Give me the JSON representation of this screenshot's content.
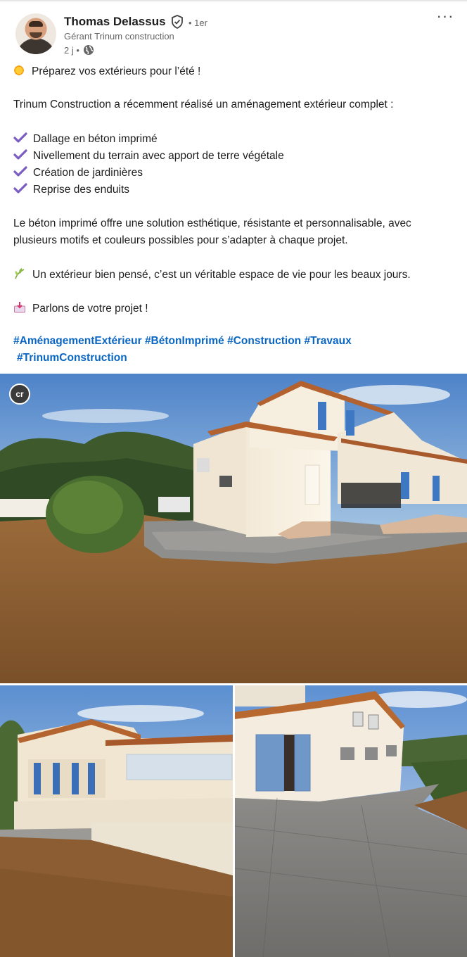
{
  "author": {
    "name": "Thomas Delassus",
    "degree": "• 1er",
    "headline": "Gérant Trinum construction",
    "time": "2 j •",
    "more_label": "···"
  },
  "post": {
    "line1": "Préparez vos extérieurs pour l’été !",
    "intro": "Trinum Construction a récemment réalisé un aménagement extérieur complet :",
    "checklist": [
      "Dallage en béton imprimé",
      "Nivellement du terrain avec apport de terre végétale",
      "Création de jardinières",
      "Reprise des enduits"
    ],
    "para1": "Le béton imprimé offre une solution esthétique, résistante et personnalisable, avec",
    "para2": "plusieurs motifs et couleurs possibles pour s’adapter à chaque projet.",
    "leaf_line": "Un extérieur bien pensé, c’est un véritable espace de vie pour les beaux jours.",
    "cta_line": "Parlons de votre projet !",
    "hashtags": [
      "#AménagementExtérieur",
      "#BétonImprimé",
      "#Construction",
      "#Travaux",
      "#TrinumConstruction"
    ]
  },
  "media": {
    "content_credentials_badge": "cr"
  },
  "colors": {
    "link": "#0a66c2",
    "check": "#7b5cc2"
  },
  "icons": [
    "verified-shield-icon",
    "globe-icon",
    "sun-icon",
    "check-icon",
    "leaf-icon",
    "inbox-icon"
  ]
}
